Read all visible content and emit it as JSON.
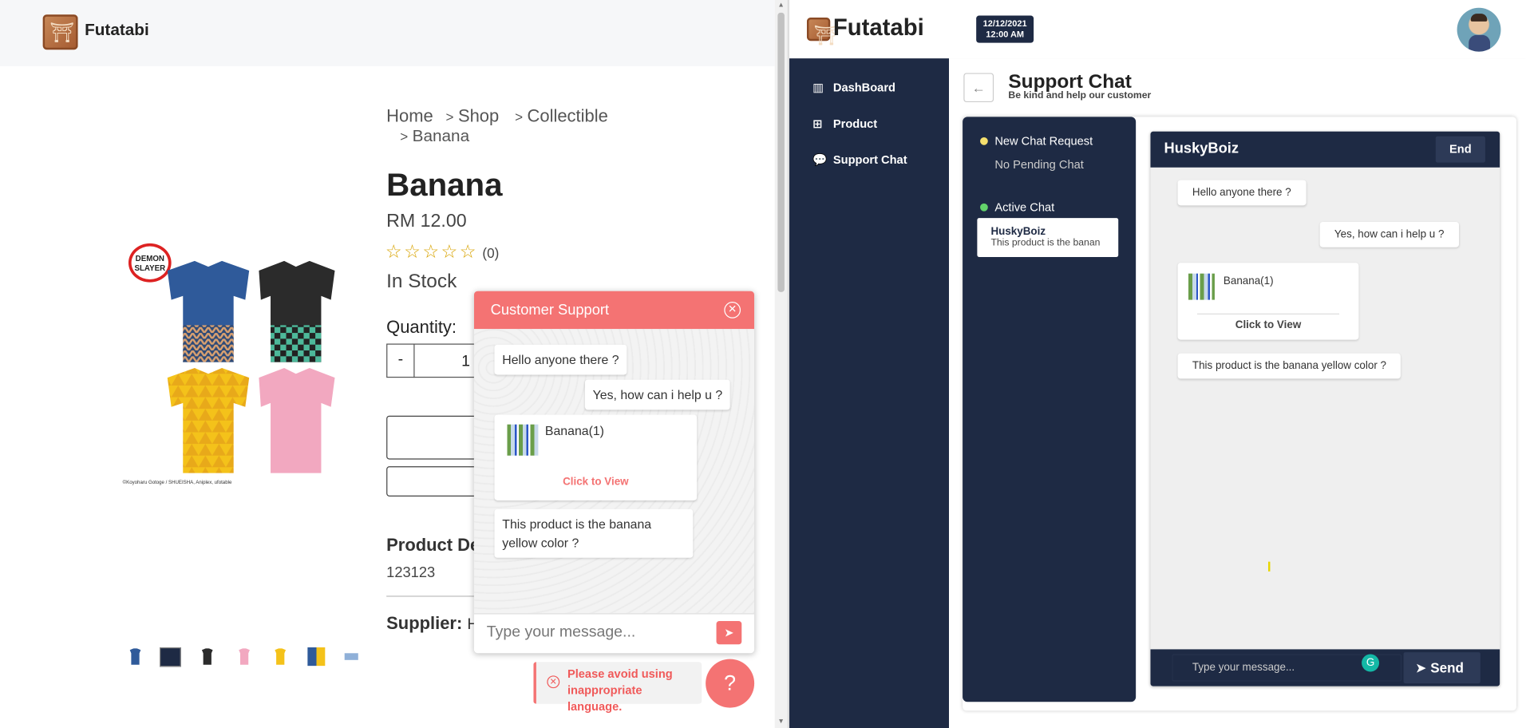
{
  "left": {
    "brand": "Futatabi",
    "breadcrumb": {
      "home": "Home",
      "shop": "Shop",
      "collectible": "Collectible",
      "current": "Banana",
      "sep": ">"
    },
    "product": {
      "title": "Banana",
      "price": "RM 12.00",
      "rating_count": "(0)",
      "stock": "In Stock",
      "quantity_label": "Quantity:",
      "quantity_value": "1",
      "minus": "-",
      "description_label": "Product Des",
      "description_value": "123123",
      "supplier_label": "Supplier:",
      "supplier_value": "He",
      "image_credit": "©Koyoharu Gotoge / SHUEISHA, Aniplex, ufotable",
      "logo_text": "DEMON SLAYER"
    },
    "chat_widget": {
      "title": "Customer Support",
      "messages": [
        {
          "text": "Hello anyone there ?"
        },
        {
          "text": "Yes, how can i help u ?"
        },
        {
          "text": "This product is the banana yellow color ?"
        }
      ],
      "product_card": {
        "name": "Banana(1)",
        "link": "Click to View"
      },
      "input_placeholder": "Type your message..."
    },
    "warning": "Please avoid using inappropriate language.",
    "colors": {
      "accent": "#f47373"
    }
  },
  "right": {
    "brand": "Futatabi",
    "date": "12/12/2021",
    "time": "12:00 AM",
    "nav": [
      {
        "label": "DashBoard",
        "icon": "chart-icon"
      },
      {
        "label": "Product",
        "icon": "box-icon"
      },
      {
        "label": "Support Chat",
        "icon": "chat-icon"
      }
    ],
    "page_title": "Support Chat",
    "page_subtitle": "Be kind and help our customer",
    "back_icon": "←",
    "new_request_label": "New Chat Request",
    "no_pending": "No Pending Chat",
    "active_label": "Active Chat",
    "active_chat": {
      "name": "HuskyBoiz",
      "preview": "This product is the banan"
    },
    "chat": {
      "user": "HuskyBoiz",
      "end_label": "End",
      "messages": [
        {
          "text": "Hello anyone there ?"
        },
        {
          "text": "Yes, how can i help u ?"
        },
        {
          "text": "This product is the banana yellow color ?"
        }
      ],
      "product_card": {
        "name": "Banana(1)",
        "link": "Click to View"
      },
      "input_placeholder": "Type your message...",
      "send_label": "Send"
    },
    "colors": {
      "navy": "#1e2a44",
      "pending_dot": "#f5e06e",
      "active_dot": "#63d36b"
    }
  }
}
